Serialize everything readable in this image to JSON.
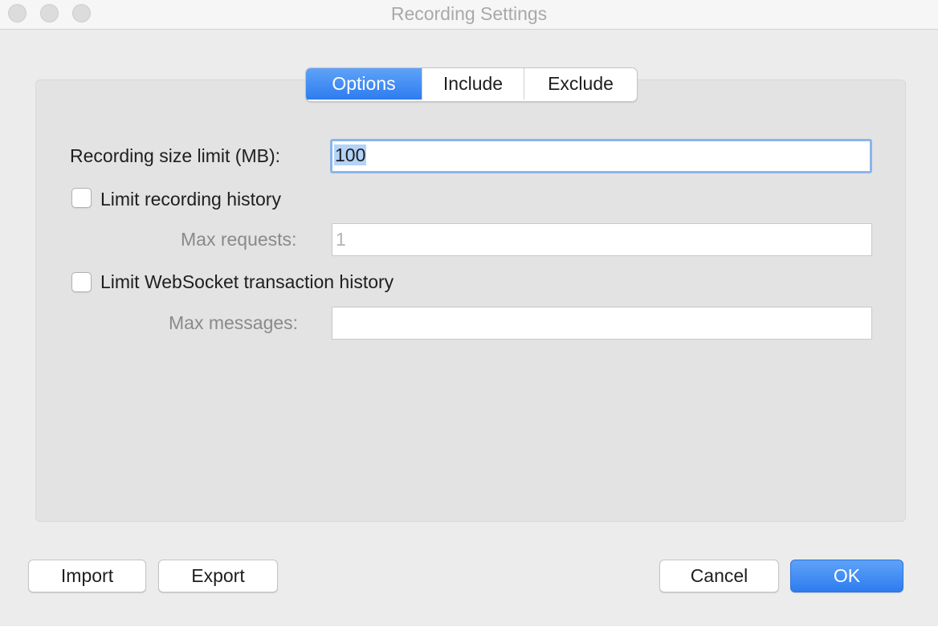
{
  "window": {
    "title": "Recording Settings"
  },
  "tabs": [
    {
      "label": "Options",
      "active": true
    },
    {
      "label": "Include",
      "active": false
    },
    {
      "label": "Exclude",
      "active": false
    }
  ],
  "options": {
    "size_limit_label": "Recording size limit (MB):",
    "size_limit_value": "100",
    "limit_history_label": "Limit recording history",
    "limit_history_checked": false,
    "max_requests_label": "Max requests:",
    "max_requests_value": "1",
    "limit_websocket_label": "Limit WebSocket transaction history",
    "limit_websocket_checked": false,
    "max_messages_label": "Max messages:",
    "max_messages_value": ""
  },
  "footer": {
    "import_label": "Import",
    "export_label": "Export",
    "cancel_label": "Cancel",
    "ok_label": "OK"
  },
  "colors": {
    "accent": "#2d7cf0",
    "window_bg": "#ececec",
    "panel_bg": "#e3e3e3",
    "focus_ring": "#8ab5ec"
  }
}
